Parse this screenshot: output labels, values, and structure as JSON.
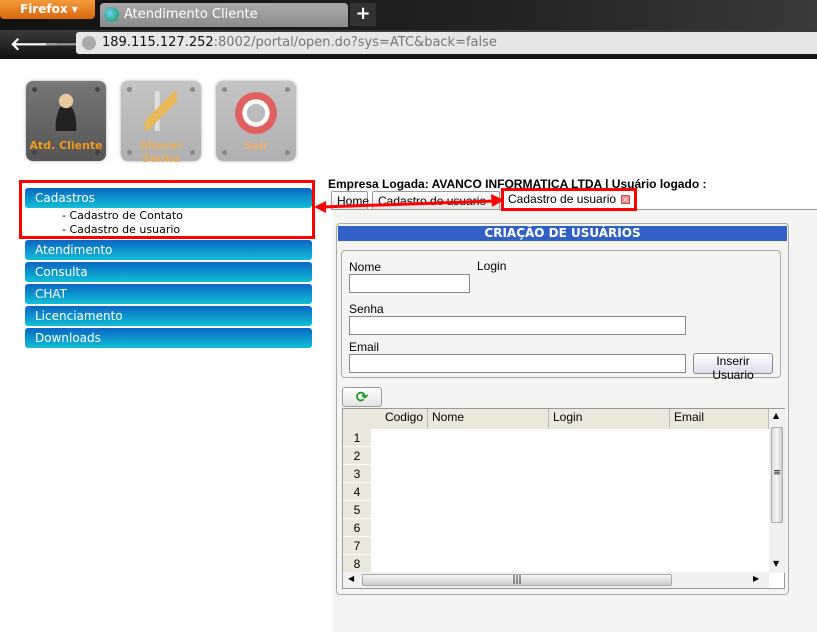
{
  "browser": {
    "menu_button": "Firefox",
    "tab_title": "Atendimento Cliente",
    "new_tab": "+",
    "url_host": "189.115.127.252",
    "url_rest": ":8002/portal/open.do?sys=ATC&back=false"
  },
  "app_buttons": [
    {
      "label": "Atd. Cliente",
      "icon": "users-icon"
    },
    {
      "label": "Alterar Senha",
      "icon": "keys-icon"
    },
    {
      "label": "Sair",
      "icon": "power-icon"
    }
  ],
  "sidebar": {
    "items": [
      {
        "label": "Cadastros",
        "subitems": [
          "- Cadastro de Contato",
          "- Cadastro de usuario"
        ]
      },
      {
        "label": "Atendimento"
      },
      {
        "label": "Consulta"
      },
      {
        "label": "CHAT"
      },
      {
        "label": "Licenciamento"
      },
      {
        "label": "Downloads"
      }
    ]
  },
  "header": {
    "empresa": "Empresa Logada: AVANCO INFORMATICA LTDA | Usuário logado :"
  },
  "tabs": [
    {
      "label": "Home"
    },
    {
      "label": "Cadastro de usuario"
    },
    {
      "label": "Cadastro de usuario",
      "active": true
    }
  ],
  "form": {
    "title": "CRIAÇÃO DE USUÁRIOS",
    "nome_label": "Nome",
    "login_label": "Login",
    "senha_label": "Senha",
    "email_label": "Email",
    "nome_value": "",
    "senha_value": "",
    "email_value": "",
    "insert_button": "Inserir Usuario"
  },
  "grid": {
    "columns": [
      "Codigo",
      "Nome",
      "Login",
      "Email"
    ],
    "row_numbers": [
      "1",
      "2",
      "3",
      "4",
      "5",
      "6",
      "7",
      "8"
    ]
  },
  "colors": {
    "accent_blue": "#3160c6",
    "menu_gradient_top": "#0a66c6",
    "menu_gradient_bottom": "#10bfd4",
    "highlight_red": "#ff0000"
  }
}
